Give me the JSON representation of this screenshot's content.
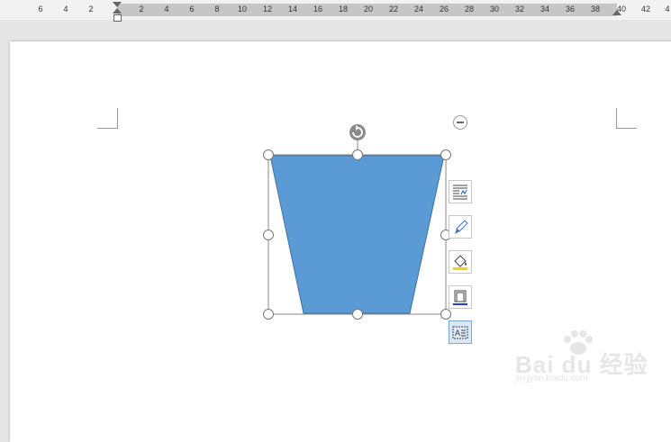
{
  "ruler": {
    "ticks_left": [
      "6",
      "4",
      "2"
    ],
    "ticks_right": [
      "2",
      "4",
      "6",
      "8",
      "10",
      "12",
      "14",
      "16",
      "18",
      "20",
      "22",
      "24",
      "26",
      "28",
      "30",
      "32",
      "34",
      "36",
      "38",
      "40",
      "42",
      "4"
    ]
  },
  "shape": {
    "fill_color": "#5b9bd5",
    "outline_color": "#41719c",
    "type": "trapezoid"
  },
  "side_toolbar": {
    "items": [
      {
        "name": "layout-options-icon"
      },
      {
        "name": "shape-styles-icon"
      },
      {
        "name": "shape-fill-icon"
      },
      {
        "name": "shape-outline-icon"
      },
      {
        "name": "text-box-icon"
      }
    ]
  },
  "watermark": {
    "logo": "Bai du 经验",
    "url": "jingyan.baidu.com"
  }
}
